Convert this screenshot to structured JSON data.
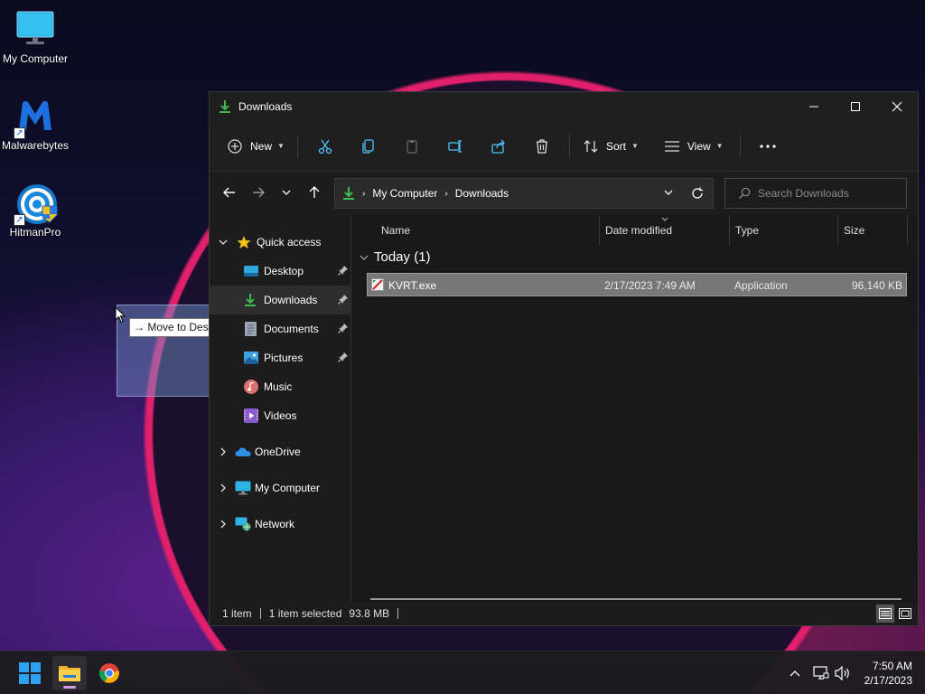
{
  "desktop": {
    "icons": [
      {
        "label": "My Computer",
        "icon": "monitor-icon"
      },
      {
        "label": "Malwarebytes",
        "icon": "malwarebytes-icon"
      },
      {
        "label": "HitmanPro",
        "icon": "hitmanpro-icon"
      }
    ],
    "drag_tooltip": "Move to Desktop"
  },
  "window": {
    "title": "Downloads",
    "toolbar": {
      "new_label": "New",
      "sort_label": "Sort",
      "view_label": "View"
    },
    "address": {
      "crumbs": [
        "My Computer",
        "Downloads"
      ]
    },
    "search": {
      "placeholder": "Search Downloads"
    },
    "sidebar": {
      "quick_access": "Quick access",
      "items": [
        {
          "label": "Desktop",
          "pinned": true
        },
        {
          "label": "Downloads",
          "pinned": true
        },
        {
          "label": "Documents",
          "pinned": true
        },
        {
          "label": "Pictures",
          "pinned": true
        },
        {
          "label": "Music",
          "pinned": false
        },
        {
          "label": "Videos",
          "pinned": false
        }
      ],
      "roots": [
        {
          "label": "OneDrive"
        },
        {
          "label": "My Computer"
        },
        {
          "label": "Network"
        }
      ]
    },
    "columns": {
      "name": "Name",
      "date": "Date modified",
      "type": "Type",
      "size": "Size"
    },
    "group": {
      "label": "Today (1)"
    },
    "files": [
      {
        "name": "KVRT.exe",
        "date": "2/17/2023 7:49 AM",
        "type": "Application",
        "size": "96,140 KB"
      }
    ],
    "status": {
      "items": "1 item",
      "selected": "1 item selected",
      "size": "93.8 MB"
    }
  },
  "taskbar": {
    "time": "7:50 AM",
    "date": "2/17/2023"
  },
  "colors": {
    "accent": "#4cc2ff",
    "download_green": "#3fb950",
    "selection": "#777777"
  }
}
